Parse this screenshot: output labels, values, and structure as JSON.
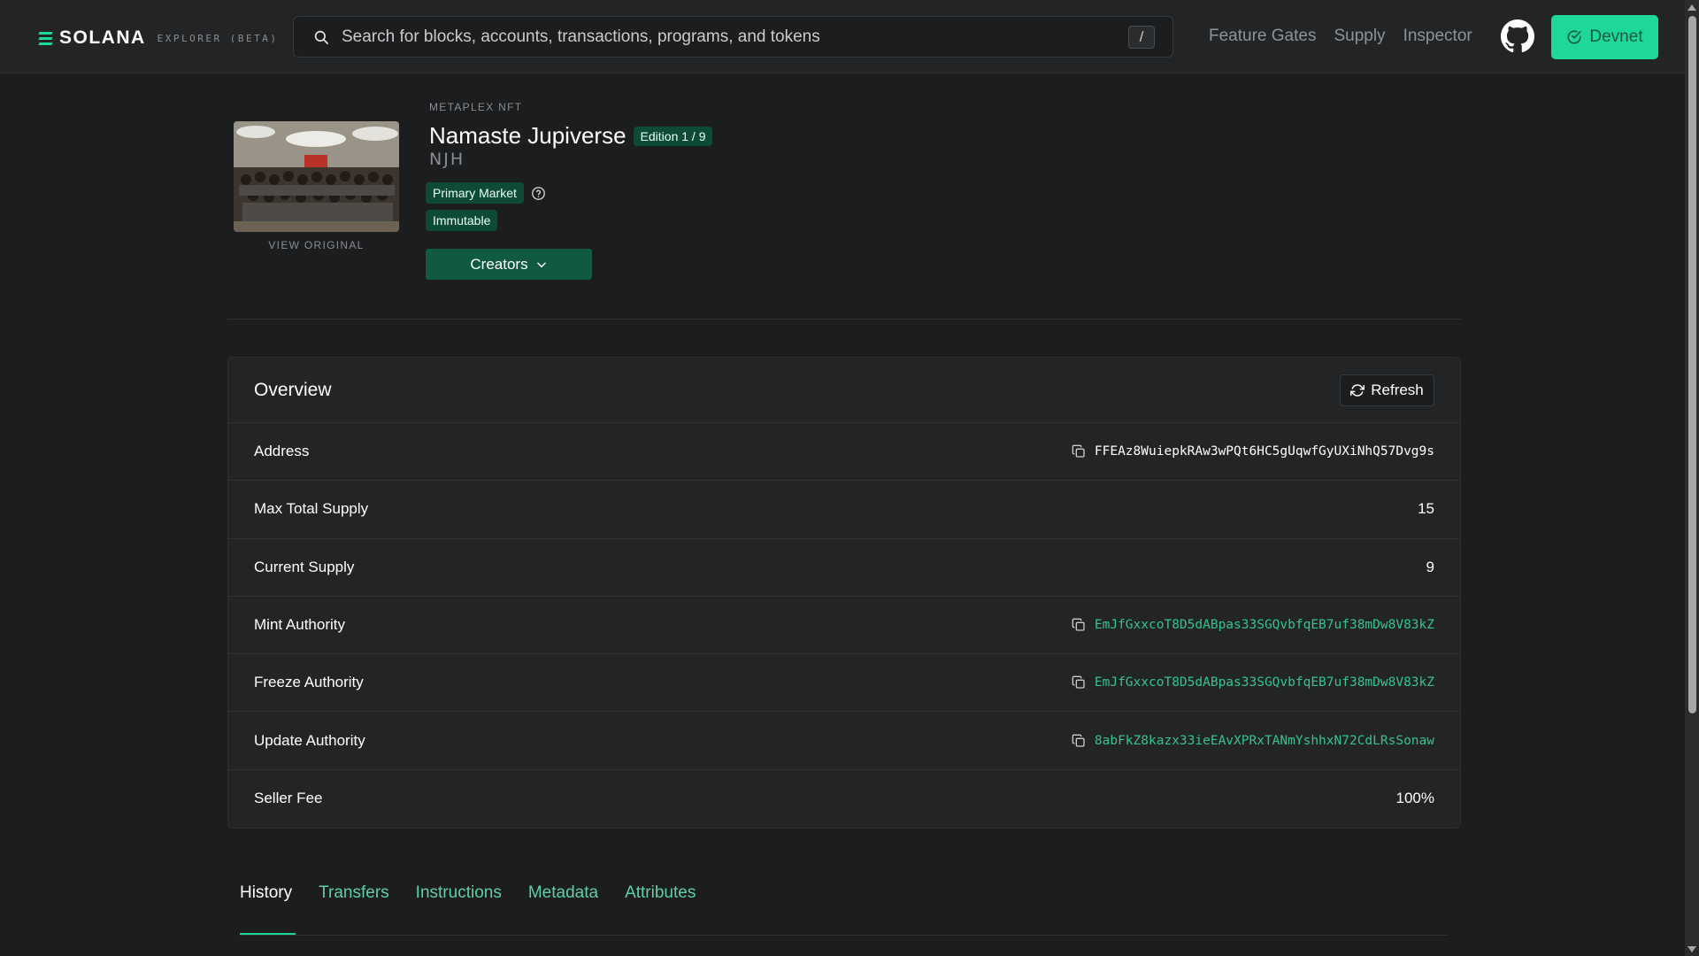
{
  "navbar": {
    "logo_text": "SOLANA",
    "logo_subtitle": "EXPLORER (BETA)",
    "search_placeholder": "Search for blocks, accounts, transactions, programs, and tokens",
    "search_shortcut": "/",
    "links": [
      "Feature Gates",
      "Supply",
      "Inspector"
    ],
    "github_icon": "github-icon",
    "cluster_label": "Devnet"
  },
  "header": {
    "pretitle": "METAPLEX NFT",
    "title": "Namaste Jupiverse",
    "edition_badge": "Edition 1 / 9",
    "symbol": "NJH",
    "badges": {
      "primary_market": "Primary Market",
      "immutable": "Immutable"
    },
    "view_original": "VIEW ORIGINAL",
    "creators_label": "Creators"
  },
  "overview": {
    "title": "Overview",
    "refresh_label": "Refresh",
    "rows": [
      {
        "label": "Address",
        "value": "FFEAz8WuiepkRAw3wPQt6HC5gUqwfGyUXiNhQ57Dvg9s"
      },
      {
        "label": "Max Total Supply",
        "value": "15"
      },
      {
        "label": "Current Supply",
        "value": "9"
      },
      {
        "label": "Mint Authority",
        "value": "EmJfGxxcoT8D5dABpas33SGQvbfqEB7uf38mDw8V83kZ"
      },
      {
        "label": "Freeze Authority",
        "value": "EmJfGxxcoT8D5dABpas33SGQvbfqEB7uf38mDw8V83kZ"
      },
      {
        "label": "Update Authority",
        "value": "8abFkZ8kazx33ieEAvXPRxTANmYshhxN72CdLRsSonaw"
      },
      {
        "label": "Seller Fee",
        "value": "100%"
      }
    ]
  },
  "tabs": [
    "History",
    "Transfers",
    "Instructions",
    "Metadata",
    "Attributes"
  ],
  "active_tab": "History",
  "colors": {
    "accent": "#1dd79b",
    "badge_bg": "#0d4a38",
    "link_green": "#33c48e",
    "background": "#1c1d1e",
    "card_bg": "#232425"
  }
}
